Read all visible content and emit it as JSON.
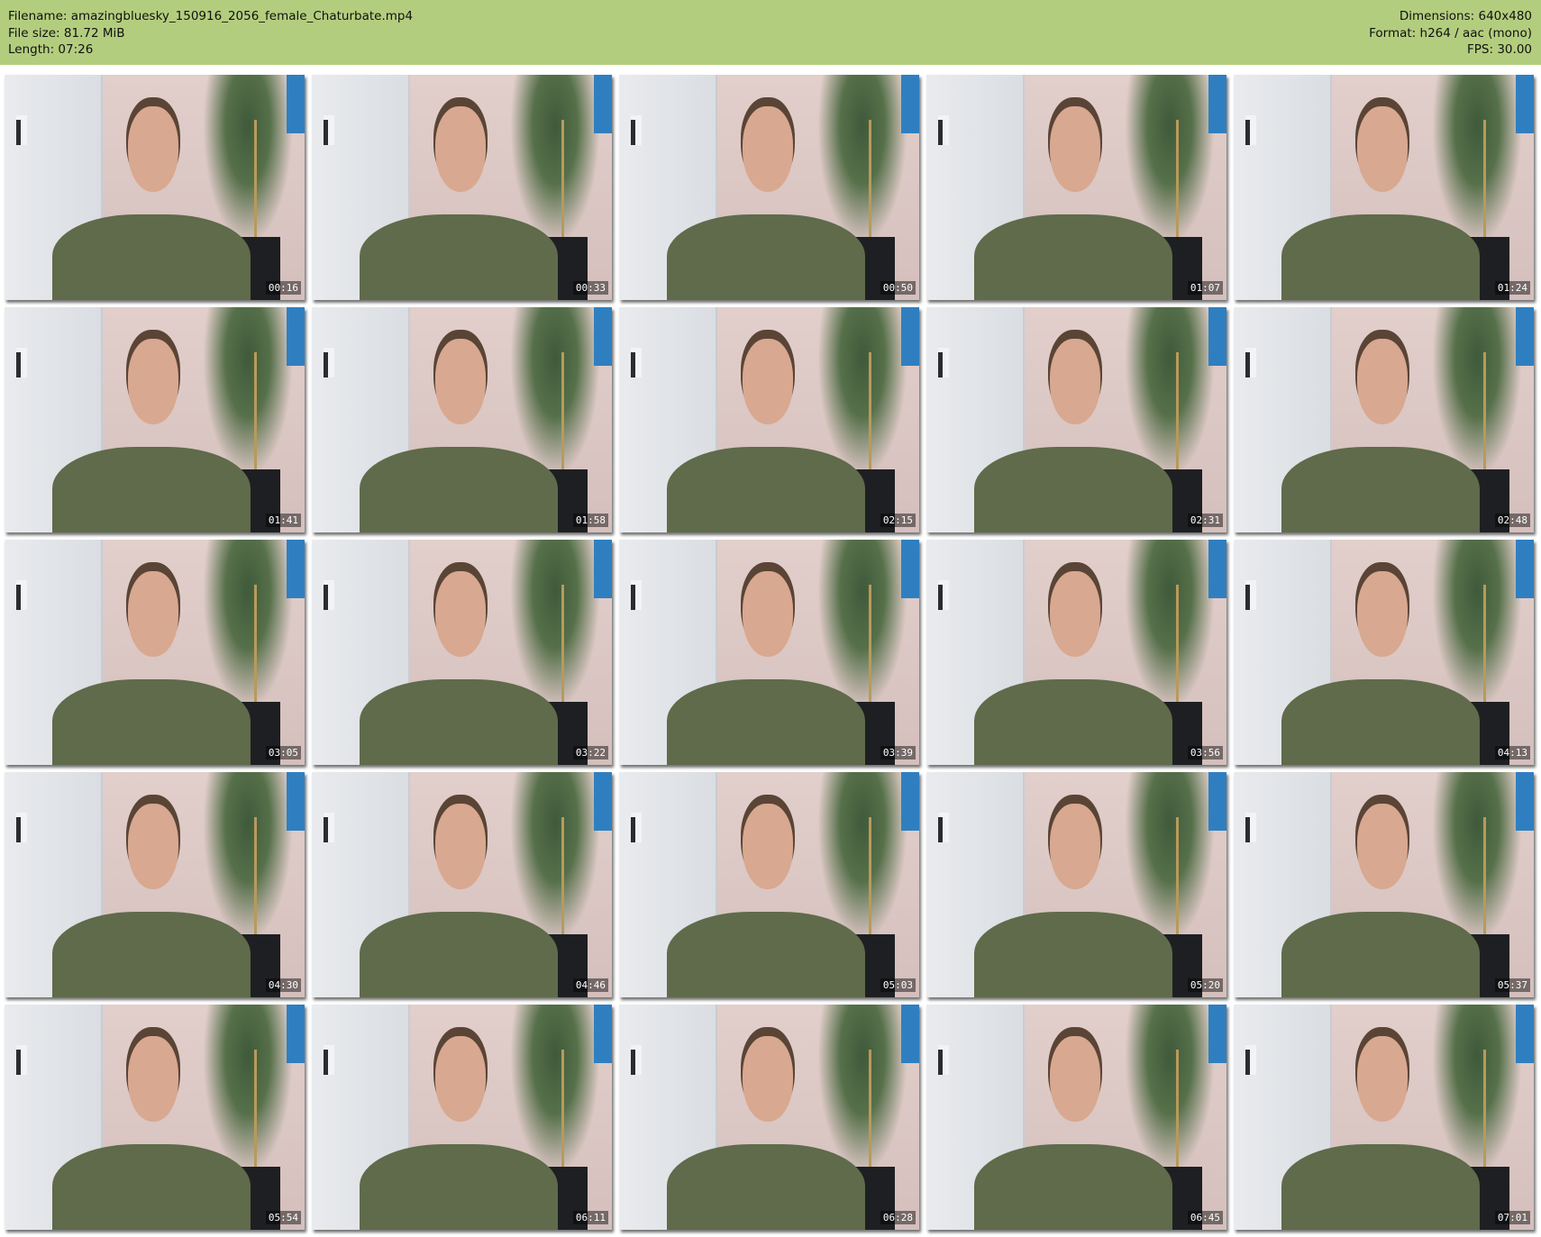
{
  "header": {
    "filename": "Filename: amazingbluesky_150916_2056_female_Chaturbate.mp4",
    "filesize": "File size: 81.72 MiB",
    "length": "Length: 07:26",
    "dimensions": "Dimensions: 640x480",
    "format": "Format: h264 / aac (mono)",
    "fps": "FPS: 30.00"
  },
  "thumbnails": [
    {
      "time": "00:16"
    },
    {
      "time": "00:33"
    },
    {
      "time": "00:50"
    },
    {
      "time": "01:07"
    },
    {
      "time": "01:24"
    },
    {
      "time": "01:41"
    },
    {
      "time": "01:58"
    },
    {
      "time": "02:15"
    },
    {
      "time": "02:31"
    },
    {
      "time": "02:48"
    },
    {
      "time": "03:05"
    },
    {
      "time": "03:22"
    },
    {
      "time": "03:39"
    },
    {
      "time": "03:56"
    },
    {
      "time": "04:13"
    },
    {
      "time": "04:30"
    },
    {
      "time": "04:46"
    },
    {
      "time": "05:03"
    },
    {
      "time": "05:20"
    },
    {
      "time": "05:37"
    },
    {
      "time": "05:54"
    },
    {
      "time": "06:11"
    },
    {
      "time": "06:28"
    },
    {
      "time": "06:45"
    },
    {
      "time": "07:01"
    }
  ],
  "colors": {
    "header_bg": "#b3cd7e"
  }
}
